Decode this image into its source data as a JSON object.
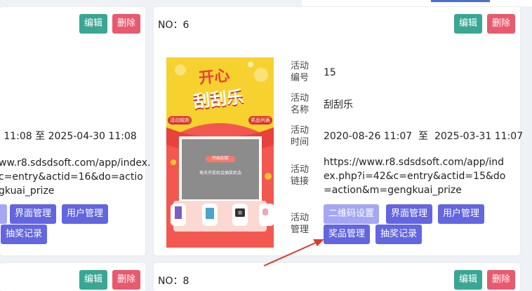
{
  "left_card": {
    "edit_label": "编辑",
    "delete_label": "删除",
    "time_fragment": "5 11:08  至  2025-04-30 11:08",
    "link_fragment": [
      "ww.r8.sdsdsoft.com/app/index.",
      "c=entry&actid=16&do=actio",
      "gkuai_prize"
    ],
    "buttons_row1": [
      "",
      "界面管理",
      "用户管理"
    ],
    "buttons_row2": [
      "抽奖记录"
    ]
  },
  "main_card": {
    "title": "NO：6",
    "edit_label": "编辑",
    "delete_label": "删除",
    "fields": {
      "id_label": "活动编号",
      "id_value": "15",
      "name_label": "活动名称",
      "name_value": "刮刮乐",
      "time_label": "活动时间",
      "time_value": "2020-08-26 11:07  至  2025-03-31 11:07",
      "link_label": "活动链接",
      "link_value": "https://www.r8.sdsdsoft.com/app/index.php?i=42&c=entry&actid=15&do=action&m=gengkuai_prize",
      "manage_label": "活动管理"
    },
    "buttons": {
      "qr": "二维码设置",
      "ui": "界面管理",
      "users": "用户管理",
      "prizes": "奖品管理",
      "records": "抽奖记录"
    },
    "poster": {
      "headline": "开心",
      "subheadline": "刮刮乐",
      "pill_left": "活动规则",
      "pill_right": "奖品列表",
      "scratch_button": "开始刮奖",
      "scratch_hint": "每天开奖机会抽奖机会"
    }
  },
  "bottom_left_card": {
    "edit_label": "编辑",
    "delete_label": "删除"
  },
  "bottom_card": {
    "title": "NO：8",
    "edit_label": "编辑",
    "delete_label": "删除"
  },
  "colors": {
    "edit": "#3aa694",
    "delete": "#e85a6e",
    "manage": "#6366e0",
    "arrow": "#e0392b"
  }
}
